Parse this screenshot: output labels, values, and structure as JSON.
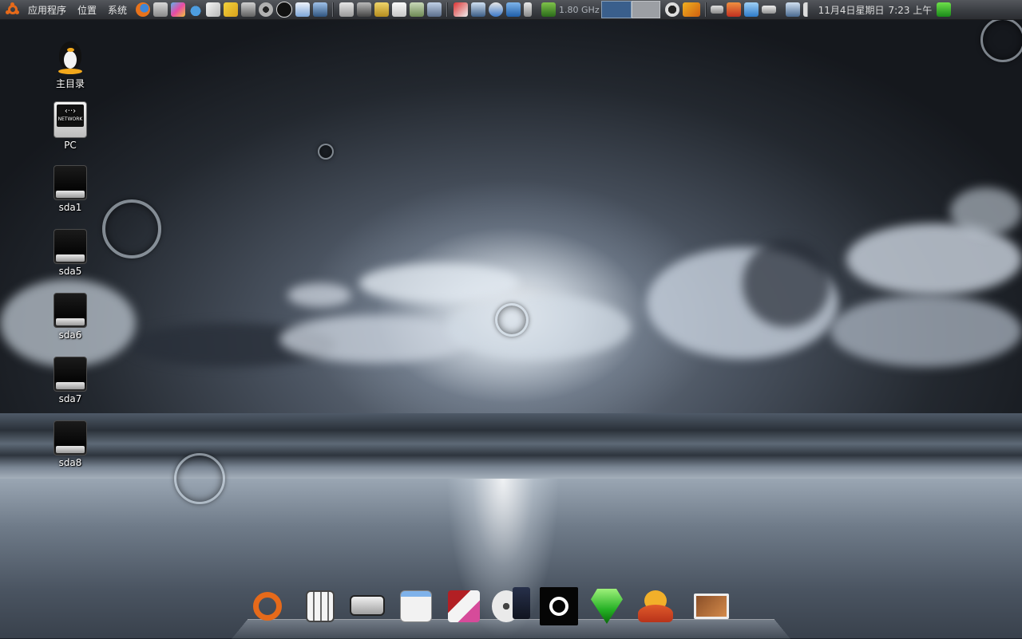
{
  "top_panel": {
    "menus": [
      "应用程序",
      "位置",
      "系统"
    ],
    "cpu_freq": "1.80 GHz",
    "date": "11月4日星期日",
    "time": "7:23 上午"
  },
  "launcher_icons": [
    "firefox-icon",
    "trash-icon",
    "paint-icon",
    "water-drop-icon",
    "gedit-note-icon",
    "pencil-icon",
    "camera-icon",
    "media-icon",
    "amarok-icon",
    "weather-icon",
    "network-monitor-icon"
  ],
  "desktop_icons": [
    {
      "name": "home-folder-icon",
      "label": "主目录"
    },
    {
      "name": "network-icon",
      "label": "PC"
    },
    {
      "name": "drive-sda1-icon",
      "label": "sda1"
    },
    {
      "name": "drive-sda5-icon",
      "label": "sda5"
    },
    {
      "name": "drive-sda6-icon",
      "label": "sda6"
    },
    {
      "name": "drive-sda7-icon",
      "label": "sda7"
    },
    {
      "name": "drive-sda8-icon",
      "label": "sda8"
    }
  ],
  "dock_items": [
    "ubuntu-icon",
    "calculator-icon",
    "hardware-icon",
    "preferences-icon",
    "installer-icon",
    "media-player-icon",
    "amarok-dock-icon",
    "emerald-icon",
    "pidgin-icon",
    "image-viewer-icon"
  ],
  "colors": {
    "panel_top": "#54575c",
    "panel_bottom": "#2b2d31",
    "ubuntu_orange": "#e66a1a",
    "cpu_graph": "#3a5f8c"
  }
}
